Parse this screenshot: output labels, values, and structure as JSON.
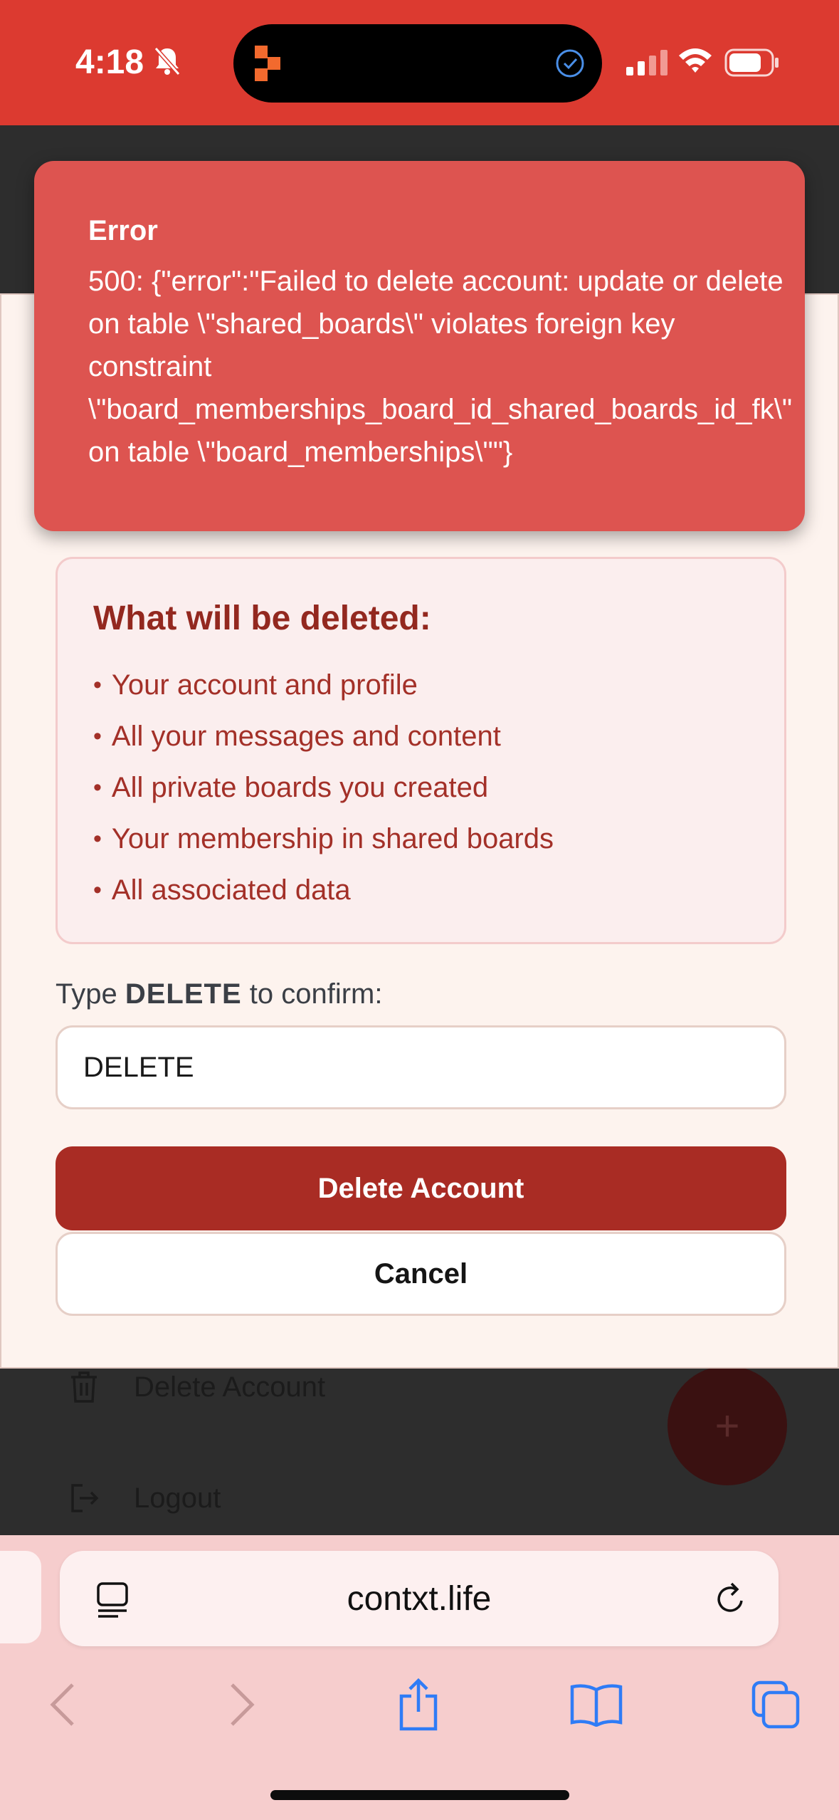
{
  "status_bar": {
    "time": "4:18",
    "bg_color": "#dc3a30",
    "icons": [
      "bell-slash-icon",
      "app-indicator-icon",
      "check-circle-icon",
      "signal-icon",
      "wifi-icon",
      "battery-icon"
    ]
  },
  "background_menu": {
    "items": [
      {
        "label": "Delete Account",
        "icon": "trash-icon"
      },
      {
        "label": "Logout",
        "icon": "logout-icon"
      }
    ],
    "fab_label": "+"
  },
  "error_toast": {
    "title": "Error",
    "message_lines": [
      "500: {\"error\":\"Failed to delete account: update or delete",
      "on table \\\"shared_boards\\\" violates foreign key",
      "constraint",
      "\\\"board_memberships_board_id_shared_boards_id_fk\\\"",
      "on table \\\"board_memberships\\\"\"}"
    ],
    "bg_color": "#dd5450"
  },
  "modal": {
    "deleted_box": {
      "title": "What will be deleted:",
      "items": [
        "Your account and profile",
        "All your messages and content",
        "All private boards you created",
        "Your membership in shared boards",
        "All associated data"
      ]
    },
    "confirm": {
      "prefix": "Type ",
      "keyword": "DELETE",
      "suffix": " to confirm:",
      "input_value": "DELETE"
    },
    "delete_button": "Delete Account",
    "cancel_button": "Cancel",
    "danger_color": "#a92c24"
  },
  "browser": {
    "url": "contxt.life",
    "toolbar": [
      "back-icon",
      "forward-icon",
      "share-icon",
      "bookmarks-icon",
      "tabs-icon"
    ]
  }
}
